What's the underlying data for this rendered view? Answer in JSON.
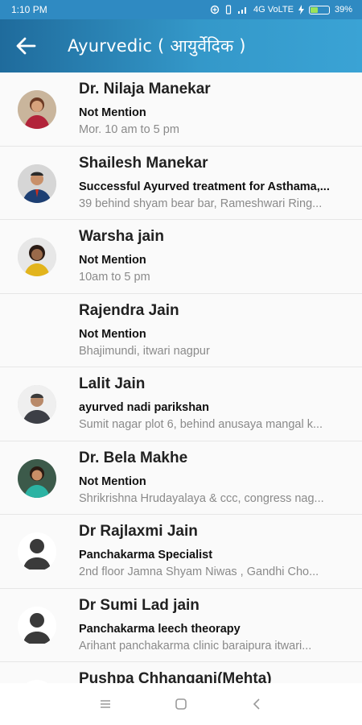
{
  "status": {
    "time": "1:10 PM",
    "network": "4G VoLTE",
    "battery": "39%",
    "battery_level": 0.39
  },
  "header": {
    "title": "Ayurvedic ( आयुर्वेदिक )"
  },
  "colors": {
    "accent": "#2f8ac2",
    "battery_fill": "#9be35a"
  },
  "doctors": [
    {
      "name": "Dr. Nilaja Manekar",
      "speciality": "Not Mention",
      "detail": "Mor. 10 am to 5 pm",
      "avatar": "photo-woman-red"
    },
    {
      "name": "Shailesh Manekar",
      "speciality": "Successful Ayurved treatment for Asthama,...",
      "detail": "39 behind shyam bear bar, Rameshwari Ring...",
      "avatar": "photo-man-suit"
    },
    {
      "name": "Warsha jain",
      "speciality": "Not Mention",
      "detail": "10am to 5 pm",
      "avatar": "photo-woman-yellow"
    },
    {
      "name": "Rajendra Jain",
      "speciality": "Not Mention",
      "detail": "Bhajimundi, itwari nagpur",
      "avatar": "none"
    },
    {
      "name": "Lalit Jain",
      "speciality": "ayurved nadi parikshan",
      "detail": "Sumit nagar plot 6, behind anusaya mangal k...",
      "avatar": "photo-man-grey"
    },
    {
      "name": "Dr. Bela  Makhe",
      "speciality": "Not Mention",
      "detail": "Shrikrishna Hrudayalaya & ccc, congress nag...",
      "avatar": "photo-woman-teal"
    },
    {
      "name": "Dr Rajlaxmi Jain",
      "speciality": "Panchakarma Specialist",
      "detail": "2nd floor Jamna Shyam Niwas , Gandhi Cho...",
      "avatar": "placeholder"
    },
    {
      "name": "Dr Sumi Lad jain",
      "speciality": "Panchakarma leech theorapy",
      "detail": "Arihant panchakarma clinic baraipura itwari...",
      "avatar": "placeholder"
    },
    {
      "name": "Pushpa Chhangani(Mehta)",
      "speciality": "",
      "detail": "",
      "avatar": "placeholder"
    }
  ],
  "nav": {
    "icons": [
      "menu-icon",
      "home-square-icon",
      "back-chevron-icon"
    ]
  }
}
